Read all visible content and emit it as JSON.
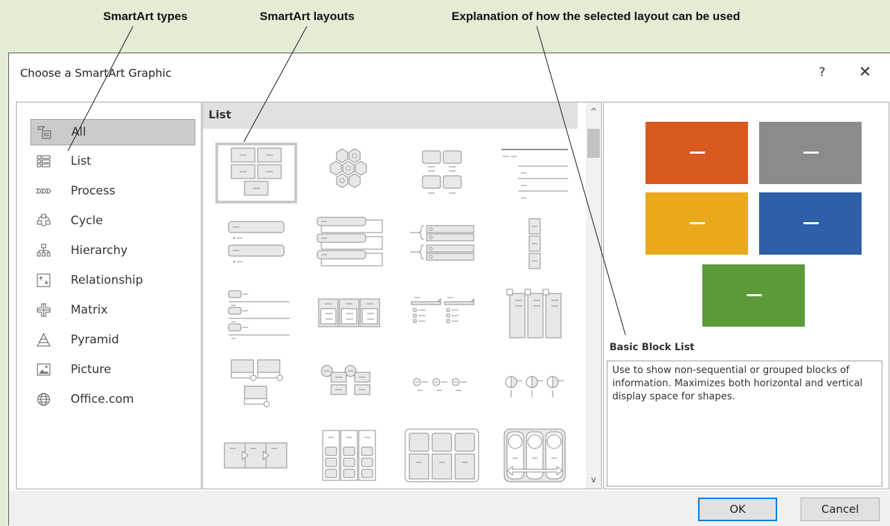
{
  "callouts": {
    "types": "SmartArt types",
    "layouts": "SmartArt layouts",
    "explanation": "Explanation of how the selected layout can be used"
  },
  "dialog": {
    "title": "Choose a SmartArt Graphic",
    "help": "?",
    "close": "✕",
    "ok_label": "OK",
    "cancel_label": "Cancel"
  },
  "categories": [
    {
      "label": "All",
      "icon": "all-icon",
      "selected": true
    },
    {
      "label": "List",
      "icon": "list-icon"
    },
    {
      "label": "Process",
      "icon": "process-icon"
    },
    {
      "label": "Cycle",
      "icon": "cycle-icon"
    },
    {
      "label": "Hierarchy",
      "icon": "hierarchy-icon"
    },
    {
      "label": "Relationship",
      "icon": "relationship-icon"
    },
    {
      "label": "Matrix",
      "icon": "matrix-icon"
    },
    {
      "label": "Pyramid",
      "icon": "pyramid-icon"
    },
    {
      "label": "Picture",
      "icon": "picture-icon"
    },
    {
      "label": "Office.com",
      "icon": "globe-icon"
    }
  ],
  "layouts": {
    "group_header": "List",
    "selected_index": 0,
    "tile_icons": [
      "basic-block-list-icon",
      "hexagon-cluster-icon",
      "stacked-blocks-icon",
      "lined-list-icon",
      "vertical-bullet-list-icon",
      "vertical-box-list-icon",
      "bracket-list-icon",
      "vertical-block-list-icon",
      "lined-bullet-list-icon",
      "grouped-list-icon",
      "tab-list-icon",
      "pillar-list-icon",
      "picture-caption-list-icon",
      "circle-label-list-icon",
      "horizontal-bullet-list-icon",
      "pie-bullet-list-icon",
      "arrow-chevron-list-icon",
      "stacked-columns-list-icon",
      "table-list-icon",
      "circle-arrow-columns-icon"
    ]
  },
  "scrollbar": {
    "up": "^",
    "down": "v"
  },
  "preview": {
    "colors": [
      "#d95a1f",
      "#8b8b8b",
      "#eaa81b",
      "#2e5fa8",
      "#5c9a3a"
    ],
    "title": "Basic Block List",
    "description": "Use to show non-sequential or grouped blocks of information. Maximizes both horizontal and vertical display space for shapes."
  }
}
